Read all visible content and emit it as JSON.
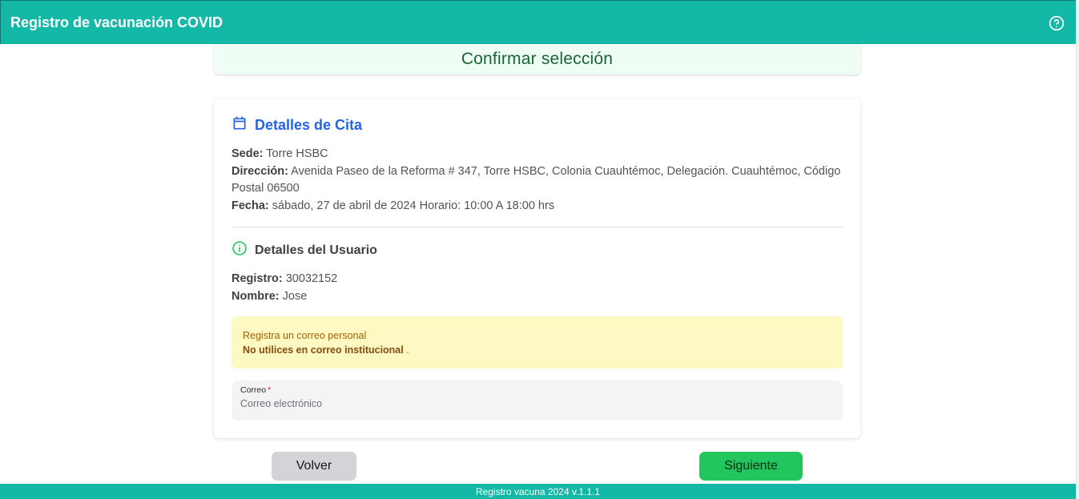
{
  "header": {
    "title": "Registro de vacunación COVID",
    "help_icon": "help-circle-icon"
  },
  "banner": {
    "title": "Confirmar selección"
  },
  "cita": {
    "icon": "calendar-icon",
    "title": "Detalles de Cita",
    "sede_label": "Sede:",
    "sede_value": "Torre HSBC",
    "direccion_label": "Dirección:",
    "direccion_value": "Avenida Paseo de la Reforma # 347, Torre HSBC, Colonia Cuauhtémoc, Delegación. Cuauhtémoc, Código Postal 06500",
    "fecha_label": "Fecha:",
    "fecha_value": "sábado, 27 de abril de 2024 Horario: 10:00 A 18:00 hrs"
  },
  "usuario": {
    "icon": "info-circle-icon",
    "title": "Detalles del Usuario",
    "registro_label": "Registro:",
    "registro_value": "30032152",
    "nombre_label": "Nombre:",
    "nombre_value": "Jose"
  },
  "warning": {
    "line1": "Registra un correo personal",
    "line2_bold": "No utilices en correo institucional",
    "line2_suffix": " ."
  },
  "email": {
    "label": "Correo",
    "required_mark": "*",
    "placeholder": "Correo electrónico",
    "value": ""
  },
  "buttons": {
    "back": "Volver",
    "next": "Siguiente"
  },
  "footer": {
    "text": "Registro vacuna 2024 v.1.1.1"
  },
  "colors": {
    "header": "#14b8a6",
    "accent_blue": "#2563eb",
    "next_button": "#22c55e",
    "warning_bg": "#fef9c3"
  }
}
